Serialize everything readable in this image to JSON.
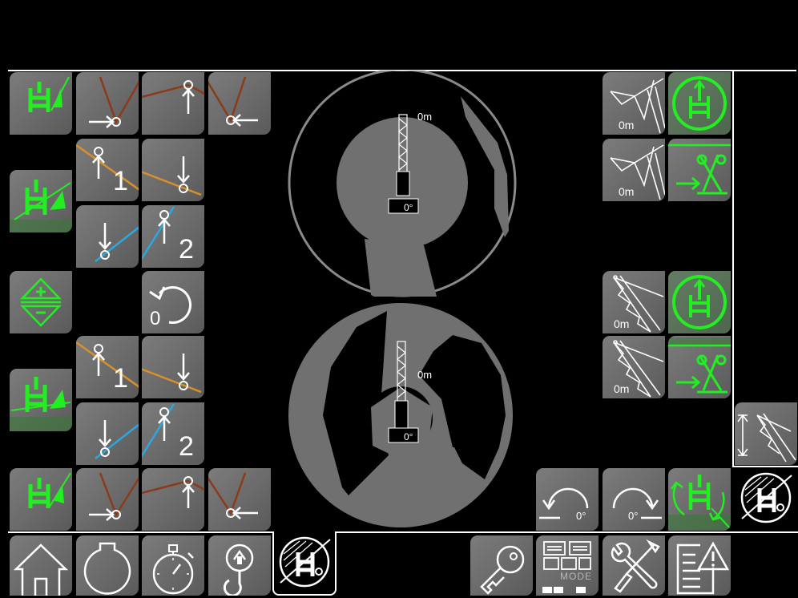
{
  "left_panel": {
    "row1": {
      "num1": "1",
      "num2": "2"
    },
    "rotate_reset": {
      "value": "0"
    },
    "row2": {
      "num1": "1",
      "num2": "2"
    }
  },
  "center": {
    "top_height": "0m",
    "top_angle": "0°",
    "bottom_height": "0m",
    "bottom_angle": "0°"
  },
  "right_panel": {
    "jib_top_1": "0m",
    "jib_top_2": "0m",
    "jib_luff_1": "0m",
    "jib_luff_2": "0m",
    "slew_left_angle": "0°",
    "slew_right_angle": "0°"
  },
  "bottom_bar": {
    "mode_label": "MODE"
  },
  "colors": {
    "button": "#707070",
    "accent_green": "#22dd22",
    "rope_brown": "#8b3a1a",
    "line_orange": "#d8902a",
    "line_blue": "#2aa8e0"
  }
}
